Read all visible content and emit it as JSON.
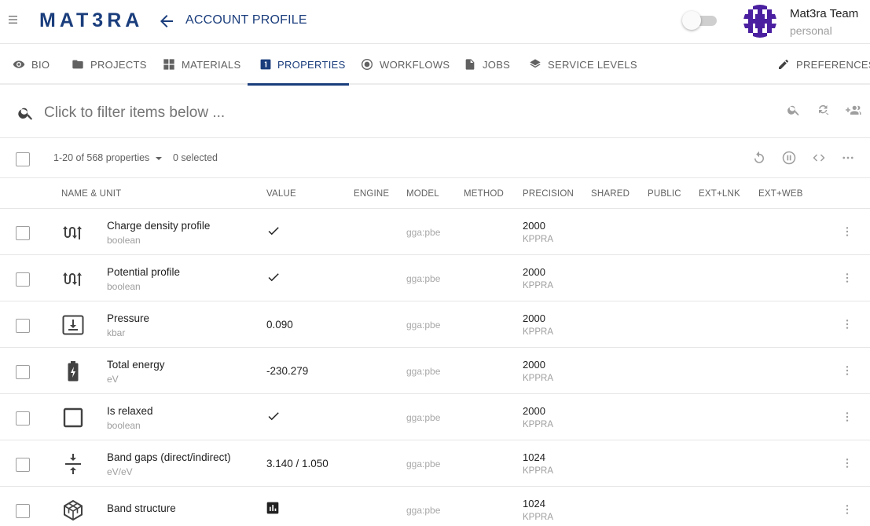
{
  "header": {
    "logo": "MAT3RA",
    "title": "ACCOUNT PROFILE",
    "team_name": "Mat3ra Team",
    "team_type": "personal",
    "accent_color": "#1a3d7c"
  },
  "tabs": [
    {
      "label": "BIO",
      "icon": "eye-icon"
    },
    {
      "label": "PROJECTS",
      "icon": "folder-icon"
    },
    {
      "label": "MATERIALS",
      "icon": "grid-icon"
    },
    {
      "label": "PROPERTIES",
      "icon": "numbered-box-icon",
      "active": true
    },
    {
      "label": "WORKFLOWS",
      "icon": "radio-target-icon"
    },
    {
      "label": "JOBS",
      "icon": "file-icon"
    },
    {
      "label": "SERVICE LEVELS",
      "icon": "layers-icon"
    },
    {
      "label": "PREFERENCES",
      "icon": "pencil-icon"
    }
  ],
  "filter": {
    "placeholder": "Click to filter items below ..."
  },
  "toolbar": {
    "range": "1-20 of 568 properties",
    "selected": "0 selected"
  },
  "columns": [
    "NAME & UNIT",
    "VALUE",
    "ENGINE",
    "MODEL",
    "METHOD",
    "PRECISION",
    "SHARED",
    "PUBLIC",
    "EXT+LNK",
    "EXT+WEB"
  ],
  "rows": [
    {
      "name": "Charge density profile",
      "unit": "boolean",
      "value": "",
      "value_icon": "check-icon",
      "icon": "wave-arrows-icon",
      "model": "gga:pbe",
      "precision": "2000",
      "precision_unit": "KPPRA"
    },
    {
      "name": "Potential profile",
      "unit": "boolean",
      "value": "",
      "value_icon": "check-icon",
      "icon": "wave-arrows-icon",
      "model": "gga:pbe",
      "precision": "2000",
      "precision_unit": "KPPRA"
    },
    {
      "name": "Pressure",
      "unit": "kbar",
      "value": "0.090",
      "value_icon": "",
      "icon": "pressure-box-icon",
      "model": "gga:pbe",
      "precision": "2000",
      "precision_unit": "KPPRA"
    },
    {
      "name": "Total energy",
      "unit": "eV",
      "value": "-230.279",
      "value_icon": "",
      "icon": "battery-bolt-icon",
      "model": "gga:pbe",
      "precision": "2000",
      "precision_unit": "KPPRA"
    },
    {
      "name": "Is relaxed",
      "unit": "boolean",
      "value": "",
      "value_icon": "check-icon",
      "icon": "square-outline-icon",
      "model": "gga:pbe",
      "precision": "2000",
      "precision_unit": "KPPRA"
    },
    {
      "name": "Band gaps (direct/indirect)",
      "unit": "eV/eV",
      "value": "3.140 / 1.050",
      "value_icon": "",
      "icon": "vertical-align-center-icon",
      "model": "gga:pbe",
      "precision": "1024",
      "precision_unit": "KPPRA"
    },
    {
      "name": "Band structure",
      "unit": "",
      "value": "",
      "value_icon": "bar-chart-icon",
      "icon": "cube-outline-icon",
      "model": "gga:pbe",
      "precision": "1024",
      "precision_unit": "KPPRA"
    }
  ]
}
